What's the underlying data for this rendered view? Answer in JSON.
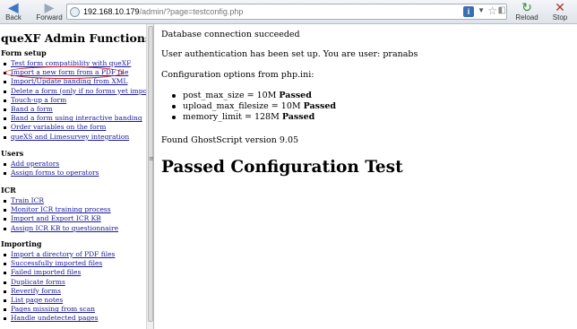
{
  "browser": {
    "back_label": "Back",
    "forward_label": "Forward",
    "reload_label": "Reload",
    "stop_label": "Stop",
    "url_host": "192.168.10.179",
    "url_path": "/admin/?page=testconfig.php"
  },
  "sidebar": {
    "title": "queXF Admin Functions",
    "sections": [
      {
        "heading": "Form setup",
        "items": [
          "Test form compatibility with queXF",
          "Import a new form from a PDF file",
          "Import/Update banding from XML",
          "Delete a form (only if no forms yet imported)",
          "Touch-up a form",
          "Band a form",
          "Band a form using interactive banding",
          "Order variables on the form",
          "queXS and Limesurvey integration"
        ]
      },
      {
        "heading": "Users",
        "items": [
          "Add operators",
          "Assign forms to operators"
        ]
      },
      {
        "heading": "ICR",
        "items": [
          "Train ICR",
          "Monitor ICR training process",
          "Import and Export ICR KB",
          "Assign ICR KB to questionnaire"
        ]
      },
      {
        "heading": "Importing",
        "items": [
          "Import a directory of PDF files",
          "Successfully imported files",
          "Failed imported files",
          "Duplicate forms",
          "Reverify forms",
          "List page notes",
          "Pages missing from scan",
          "Handle undetected pages"
        ]
      }
    ]
  },
  "main": {
    "db_message": "Database connection succeeded",
    "auth_message": "User authentication has been set up. You are user: pranabs",
    "config_heading": "Configuration options from php.ini:",
    "config_items": [
      {
        "text": "post_max_size = 10M",
        "status": "Passed"
      },
      {
        "text": "upload_max_filesize = 10M",
        "status": "Passed"
      },
      {
        "text": "memory_limit = 128M",
        "status": "Passed"
      }
    ],
    "ghostscript_message": "Found GhostScript version 9.05",
    "result_heading": "Passed Configuration Test"
  },
  "colors": {
    "link": "#1a1a9a",
    "highlight_oval": "#d01818"
  }
}
